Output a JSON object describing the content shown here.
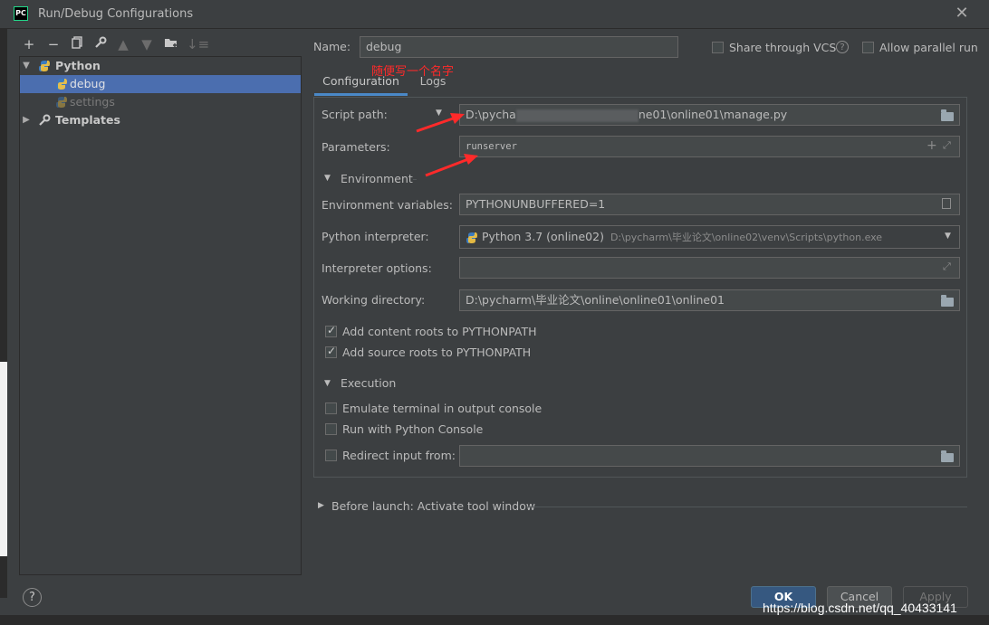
{
  "window": {
    "title": "Run/Debug Configurations",
    "app_icon": "PC"
  },
  "toolbar": {
    "icons": [
      "add-icon",
      "remove-icon",
      "copy-icon",
      "wrench-icon",
      "move-up-icon",
      "move-down-icon",
      "new-folder-icon",
      "sort-icon"
    ]
  },
  "tree": {
    "python_label": "Python",
    "debug_label": "debug",
    "settings_label": "settings",
    "templates_label": "Templates"
  },
  "form": {
    "name_label": "Name:",
    "name_value": "debug",
    "share_vcs_label": "Share through VCS",
    "allow_parallel_label": "Allow parallel run",
    "tabs": [
      "Configuration",
      "Logs"
    ],
    "script_path_label": "Script path:",
    "script_path_prefix": "D:\\pycha",
    "script_path_suffix": "ne01\\online01\\manage.py",
    "parameters_label": "Parameters:",
    "parameters_value": "runserver",
    "environment_section": "Environment",
    "env_vars_label": "Environment variables:",
    "env_vars_value": "PYTHONUNBUFFERED=1",
    "interpreter_label": "Python interpreter:",
    "interpreter_value": "Python 3.7 (online02)",
    "interpreter_path": "D:\\pycharm\\毕业论文\\online02\\venv\\Scripts\\python.exe",
    "interpreter_options_label": "Interpreter options:",
    "interpreter_options_value": "",
    "working_dir_label": "Working directory:",
    "working_dir_value": "D:\\pycharm\\毕业论文\\online\\online01\\online01",
    "add_content_roots_label": "Add content roots to PYTHONPATH",
    "add_source_roots_label": "Add source roots to PYTHONPATH",
    "execution_section": "Execution",
    "emulate_terminal_label": "Emulate terminal in output console",
    "run_python_console_label": "Run with Python Console",
    "redirect_input_label": "Redirect input from:",
    "redirect_input_value": "",
    "before_launch_label": "Before launch: Activate tool window"
  },
  "checkboxes": {
    "share_vcs": false,
    "allow_parallel": false,
    "add_content_roots": true,
    "add_source_roots": true,
    "emulate_terminal": false,
    "run_python_console": false,
    "redirect_input": false
  },
  "buttons": {
    "ok": "OK",
    "cancel": "Cancel",
    "apply": "Apply",
    "help": "?"
  },
  "annotation": {
    "text": "随便写一个名字",
    "color": "#ff2a2a"
  },
  "watermark": "https://blog.csdn.net/qq_40433141",
  "colors": {
    "selection": "#4b6eaf",
    "ok_button": "#365880",
    "background": "#3c3f41"
  }
}
